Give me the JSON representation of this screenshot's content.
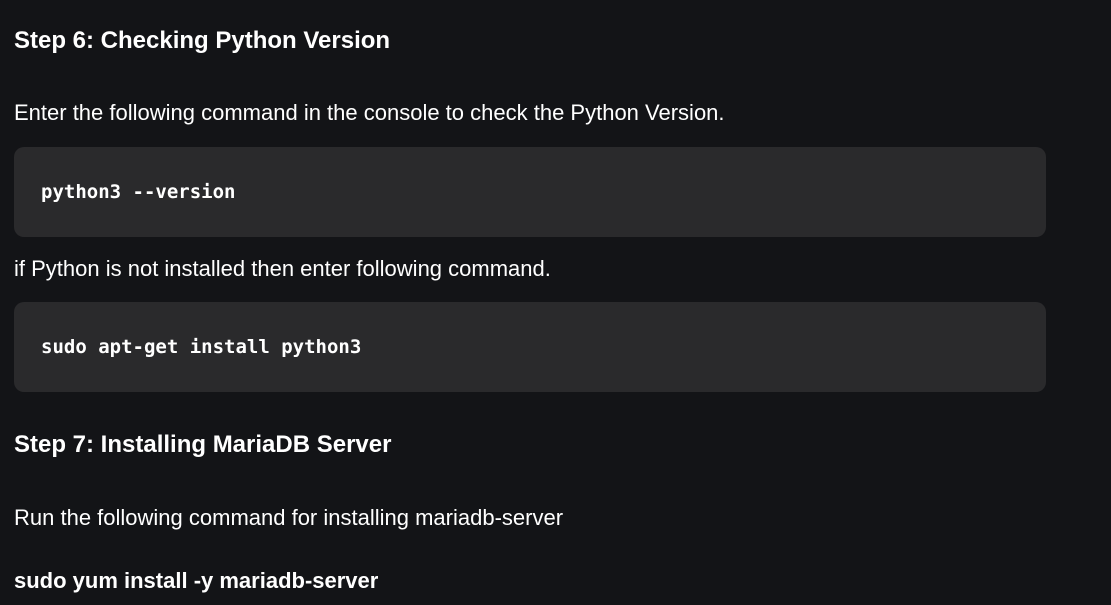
{
  "step6": {
    "heading": "Step 6: Checking Python Version",
    "intro": "Enter the following command in the console to check the Python Version.",
    "command": "python3 --version",
    "followup": "if Python is not installed then enter following command.",
    "install_command": "sudo apt-get install python3"
  },
  "step7": {
    "heading": "Step 7: Installing MariaDB Server",
    "intro": "Run the following command for installing mariadb-server",
    "command": "sudo yum install -y mariadb-server"
  },
  "colors": {
    "background": "#131417",
    "code_background": "#2a2a2c",
    "text": "#ffffff"
  }
}
